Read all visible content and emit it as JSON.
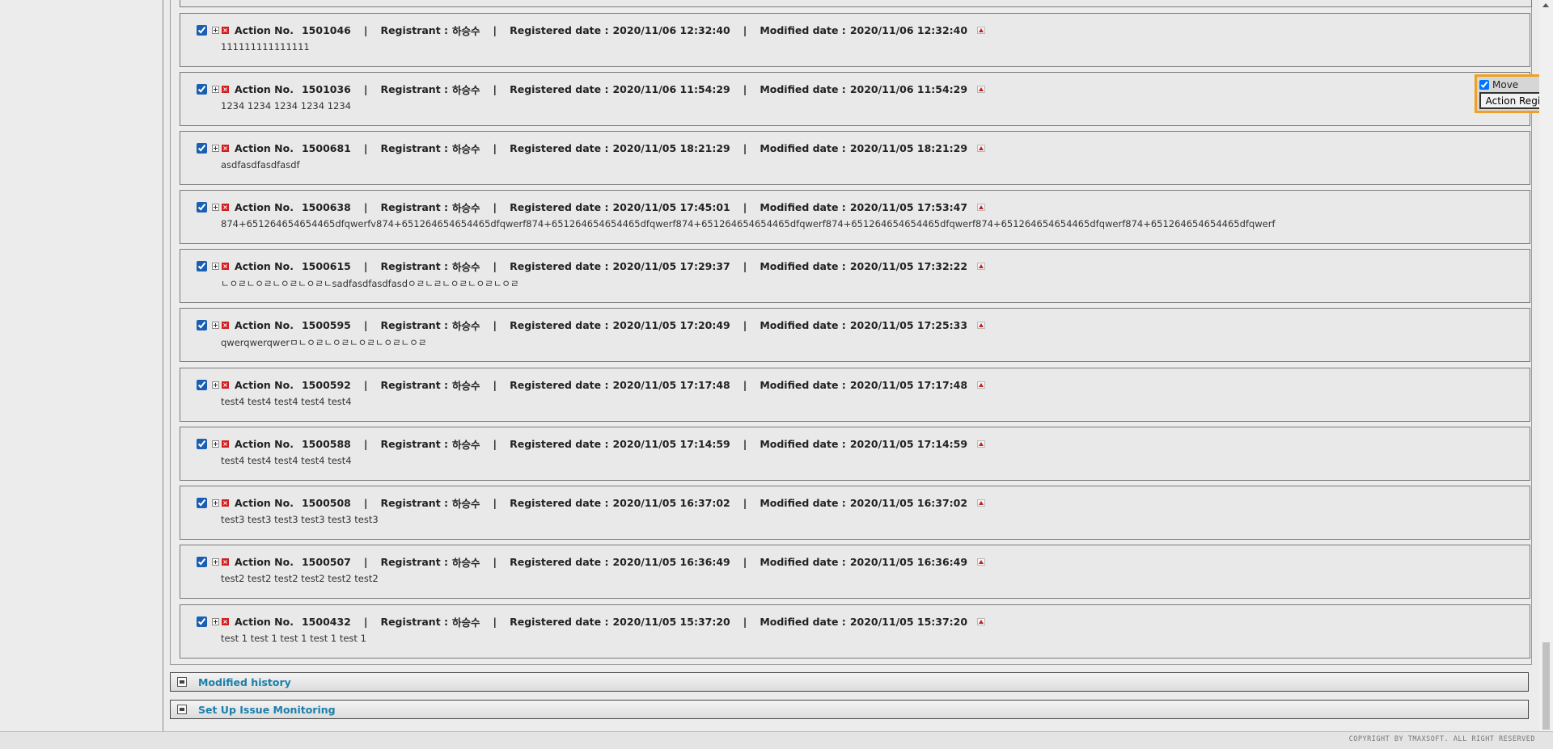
{
  "actions": [
    {
      "no": "1501046",
      "registrant": "하승수",
      "registered": "2020/11/06 12:32:40",
      "modified": "2020/11/06 12:32:40",
      "content": "111111111111111"
    },
    {
      "no": "1501036",
      "registrant": "하승수",
      "registered": "2020/11/06 11:54:29",
      "modified": "2020/11/06 11:54:29",
      "content": "1234 1234 1234 1234 1234"
    },
    {
      "no": "1500681",
      "registrant": "하승수",
      "registered": "2020/11/05 18:21:29",
      "modified": "2020/11/05 18:21:29",
      "content": "asdfasdfasdfasdf"
    },
    {
      "no": "1500638",
      "registrant": "하승수",
      "registered": "2020/11/05 17:45:01",
      "modified": "2020/11/05 17:53:47",
      "content": "874+651264654654465dfqwerfv874+651264654654465dfqwerf874+651264654654465dfqwerf874+651264654654465dfqwerf874+651264654654465dfqwerf874+651264654654465dfqwerf874+651264654654465dfqwerf"
    },
    {
      "no": "1500615",
      "registrant": "하승수",
      "registered": "2020/11/05 17:29:37",
      "modified": "2020/11/05 17:32:22",
      "content": "ㄴㅇㄹㄴㅇㄹㄴㅇㄹㄴㅇㄹㄴsadfasdfasdfasdㅇㄹㄴㄹㄴㅇㄹㄴㅇㄹㄴㅇㄹ"
    },
    {
      "no": "1500595",
      "registrant": "하승수",
      "registered": "2020/11/05 17:20:49",
      "modified": "2020/11/05 17:25:33",
      "content": "qwerqwerqwerㅁㄴㅇㄹㄴㅇㄹㄴㅇㄹㄴㅇㄹㄴㅇㄹ"
    },
    {
      "no": "1500592",
      "registrant": "하승수",
      "registered": "2020/11/05 17:17:48",
      "modified": "2020/11/05 17:17:48",
      "content": "test4 test4 test4 test4 test4"
    },
    {
      "no": "1500588",
      "registrant": "하승수",
      "registered": "2020/11/05 17:14:59",
      "modified": "2020/11/05 17:14:59",
      "content": "test4 test4 test4 test4 test4"
    },
    {
      "no": "1500508",
      "registrant": "하승수",
      "registered": "2020/11/05 16:37:02",
      "modified": "2020/11/05 16:37:02",
      "content": "test3 test3 test3 test3 test3 test3"
    },
    {
      "no": "1500507",
      "registrant": "하승수",
      "registered": "2020/11/05 16:36:49",
      "modified": "2020/11/05 16:36:49",
      "content": "test2 test2 test2 test2 test2 test2"
    },
    {
      "no": "1500432",
      "registrant": "하승수",
      "registered": "2020/11/05 15:37:20",
      "modified": "2020/11/05 15:37:20",
      "content": "test 1 test 1 test 1 test 1 test 1"
    }
  ],
  "labels": {
    "action_no": "Action No.",
    "registrant": "Registrant :",
    "registered_date": "Registered date :",
    "modified_date": "Modified date :",
    "separator": "|"
  },
  "popup": {
    "move_label": "Move",
    "move_checked": true,
    "register_button": "Action Registration"
  },
  "sections": [
    {
      "title": "Modified history"
    },
    {
      "title": "Set Up Issue Monitoring"
    }
  ],
  "footer": {
    "copyright": "COPYRIGHT BY TMAXSOFT. ALL RIGHT RESERVED"
  },
  "icons": {
    "expand": "expand-plus-icon",
    "delete": "delete-x-icon",
    "move_up": "move-up-icon"
  },
  "colors": {
    "accent_link": "#1a7faa",
    "delete_red": "#d21f1f",
    "popup_border": "#f0a020"
  }
}
